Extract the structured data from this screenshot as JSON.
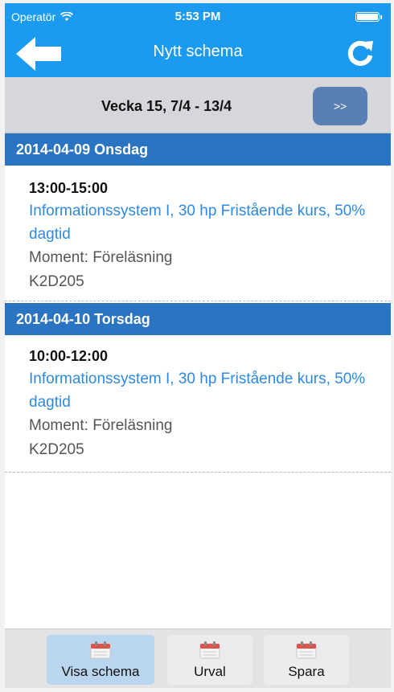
{
  "status_bar": {
    "carrier": "Operatör",
    "time": "5:53 PM"
  },
  "nav": {
    "title": "Nytt schema",
    "back_icon": "arrow-left-icon",
    "refresh_icon": "refresh-icon"
  },
  "week": {
    "label": "Vecka 15, 7/4 - 13/4",
    "next_label": ">>"
  },
  "days": [
    {
      "header": "2014-04-09 Onsdag",
      "event": {
        "time": "13:00-15:00",
        "course": "Informationssystem I, 30 hp Fristående kurs, 50% dagtid",
        "moment": "Moment: Föreläsning",
        "room": "K2D205"
      }
    },
    {
      "header": "2014-04-10 Torsdag",
      "event": {
        "time": "10:00-12:00",
        "course": "Informationssystem I, 30 hp Fristående kurs, 50% dagtid",
        "moment": "Moment: Föreläsning",
        "room": "K2D205"
      }
    }
  ],
  "tabs": [
    {
      "label": "Visa schema",
      "icon": "calendar-icon",
      "active": true
    },
    {
      "label": "Urval",
      "icon": "calendar-icon",
      "active": false
    },
    {
      "label": "Spara",
      "icon": "calendar-icon",
      "active": false
    }
  ],
  "colors": {
    "nav_blue": "#1a9bf0",
    "day_header_blue": "#2b74c2",
    "link_blue": "#2d8ae0",
    "button_blue": "#5a7fb5"
  }
}
